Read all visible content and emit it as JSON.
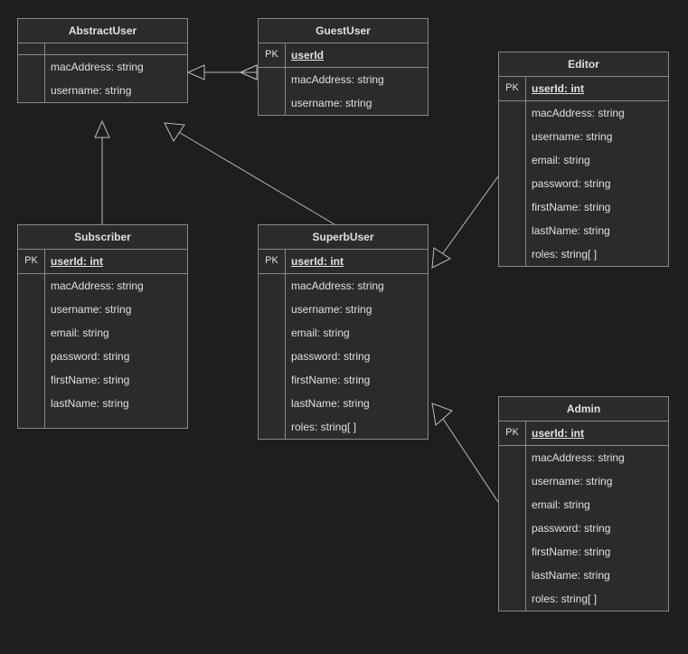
{
  "diagram_type": "UML Class Diagram",
  "classes": {
    "abstractUser": {
      "name": "AbstractUser",
      "pkLabel": "",
      "pkValue": "",
      "attrs": [
        "macAddress: string",
        "username: string"
      ]
    },
    "guestUser": {
      "name": "GuestUser",
      "pkLabel": "PK",
      "pkValue": "userId",
      "attrs": [
        "macAddress: string",
        "username: string"
      ]
    },
    "subscriber": {
      "name": "Subscriber",
      "pkLabel": "PK",
      "pkValue": "userId: int",
      "attrs": [
        "macAddress: string",
        "username: string",
        "email: string",
        "password: string",
        "firstName: string",
        "lastName: string"
      ]
    },
    "superbUser": {
      "name": "SuperbUser",
      "pkLabel": "PK",
      "pkValue": "userId: int",
      "attrs": [
        "macAddress: string",
        "username: string",
        "email: string",
        "password: string",
        "firstName: string",
        "lastName: string",
        "roles: string[ ]"
      ]
    },
    "editor": {
      "name": "Editor",
      "pkLabel": "PK",
      "pkValue": "userId: int",
      "attrs": [
        "macAddress: string",
        "username: string",
        "email: string",
        "password: string",
        "firstName: string",
        "lastName: string",
        "roles: string[ ]"
      ]
    },
    "admin": {
      "name": "Admin",
      "pkLabel": "PK",
      "pkValue": "userId: int",
      "attrs": [
        "macAddress: string",
        "username: string",
        "email: string",
        "password: string",
        "firstName: string",
        "lastName: string",
        "roles: string[ ]"
      ]
    }
  },
  "relationships": [
    {
      "from": "GuestUser",
      "to": "AbstractUser",
      "type": "inheritance"
    },
    {
      "from": "Subscriber",
      "to": "AbstractUser",
      "type": "inheritance"
    },
    {
      "from": "SuperbUser",
      "to": "AbstractUser",
      "type": "inheritance"
    },
    {
      "from": "Editor",
      "to": "SuperbUser",
      "type": "inheritance"
    },
    {
      "from": "Admin",
      "to": "SuperbUser",
      "type": "inheritance"
    }
  ]
}
